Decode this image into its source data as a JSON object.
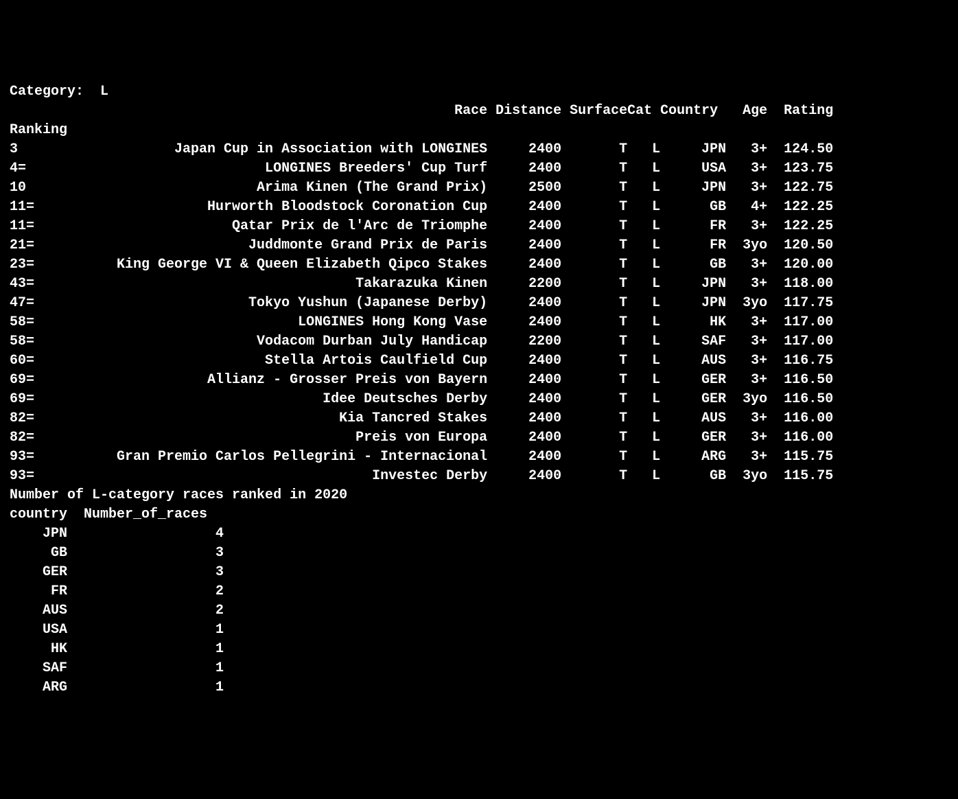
{
  "category_label": "Category:  L",
  "headers": {
    "ranking": "Ranking",
    "race": "Race",
    "distance": "Distance",
    "surface": "Surface",
    "cat": "Cat",
    "country": "Country",
    "age": "Age",
    "rating": "Rating"
  },
  "races": [
    {
      "ranking": "3",
      "race": "Japan Cup in Association with LONGINES",
      "distance": "2400",
      "surface": "T",
      "cat": "L",
      "country": "JPN",
      "age": "3+",
      "rating": "124.50"
    },
    {
      "ranking": "4=",
      "race": "LONGINES Breeders' Cup Turf",
      "distance": "2400",
      "surface": "T",
      "cat": "L",
      "country": "USA",
      "age": "3+",
      "rating": "123.75"
    },
    {
      "ranking": "10",
      "race": "Arima Kinen (The Grand Prix)",
      "distance": "2500",
      "surface": "T",
      "cat": "L",
      "country": "JPN",
      "age": "3+",
      "rating": "122.75"
    },
    {
      "ranking": "11=",
      "race": "Hurworth Bloodstock Coronation Cup",
      "distance": "2400",
      "surface": "T",
      "cat": "L",
      "country": "GB",
      "age": "4+",
      "rating": "122.25"
    },
    {
      "ranking": "11=",
      "race": "Qatar Prix de l'Arc de Triomphe",
      "distance": "2400",
      "surface": "T",
      "cat": "L",
      "country": "FR",
      "age": "3+",
      "rating": "122.25"
    },
    {
      "ranking": "21=",
      "race": "Juddmonte Grand Prix de Paris",
      "distance": "2400",
      "surface": "T",
      "cat": "L",
      "country": "FR",
      "age": "3yo",
      "rating": "120.50"
    },
    {
      "ranking": "23=",
      "race": "King George VI & Queen Elizabeth Qipco Stakes",
      "distance": "2400",
      "surface": "T",
      "cat": "L",
      "country": "GB",
      "age": "3+",
      "rating": "120.00"
    },
    {
      "ranking": "43=",
      "race": "Takarazuka Kinen",
      "distance": "2200",
      "surface": "T",
      "cat": "L",
      "country": "JPN",
      "age": "3+",
      "rating": "118.00"
    },
    {
      "ranking": "47=",
      "race": "Tokyo Yushun (Japanese Derby)",
      "distance": "2400",
      "surface": "T",
      "cat": "L",
      "country": "JPN",
      "age": "3yo",
      "rating": "117.75"
    },
    {
      "ranking": "58=",
      "race": "LONGINES Hong Kong Vase",
      "distance": "2400",
      "surface": "T",
      "cat": "L",
      "country": "HK",
      "age": "3+",
      "rating": "117.00"
    },
    {
      "ranking": "58=",
      "race": "Vodacom Durban July Handicap",
      "distance": "2200",
      "surface": "T",
      "cat": "L",
      "country": "SAF",
      "age": "3+",
      "rating": "117.00"
    },
    {
      "ranking": "60=",
      "race": "Stella Artois Caulfield Cup",
      "distance": "2400",
      "surface": "T",
      "cat": "L",
      "country": "AUS",
      "age": "3+",
      "rating": "116.75"
    },
    {
      "ranking": "69=",
      "race": "Allianz - Grosser Preis von Bayern",
      "distance": "2400",
      "surface": "T",
      "cat": "L",
      "country": "GER",
      "age": "3+",
      "rating": "116.50"
    },
    {
      "ranking": "69=",
      "race": "Idee Deutsches Derby",
      "distance": "2400",
      "surface": "T",
      "cat": "L",
      "country": "GER",
      "age": "3yo",
      "rating": "116.50"
    },
    {
      "ranking": "82=",
      "race": "Kia Tancred Stakes",
      "distance": "2400",
      "surface": "T",
      "cat": "L",
      "country": "AUS",
      "age": "3+",
      "rating": "116.00"
    },
    {
      "ranking": "82=",
      "race": "Preis von Europa",
      "distance": "2400",
      "surface": "T",
      "cat": "L",
      "country": "GER",
      "age": "3+",
      "rating": "116.00"
    },
    {
      "ranking": "93=",
      "race": "Gran Premio Carlos Pellegrini - Internacional",
      "distance": "2400",
      "surface": "T",
      "cat": "L",
      "country": "ARG",
      "age": "3+",
      "rating": "115.75"
    },
    {
      "ranking": "93=",
      "race": "Investec Derby",
      "distance": "2400",
      "surface": "T",
      "cat": "L",
      "country": "GB",
      "age": "3yo",
      "rating": "115.75"
    }
  ],
  "summary_title": "Number of L-category races ranked in 2020",
  "summary_headers": {
    "country": "country",
    "number": "Number_of_races"
  },
  "summary_rows": [
    {
      "country": "JPN",
      "number": "4"
    },
    {
      "country": "GB",
      "number": "3"
    },
    {
      "country": "GER",
      "number": "3"
    },
    {
      "country": "FR",
      "number": "2"
    },
    {
      "country": "AUS",
      "number": "2"
    },
    {
      "country": "USA",
      "number": "1"
    },
    {
      "country": "HK",
      "number": "1"
    },
    {
      "country": "SAF",
      "number": "1"
    },
    {
      "country": "ARG",
      "number": "1"
    }
  ],
  "chart_data": [
    {
      "type": "table",
      "title": "Category: L races",
      "columns": [
        "Ranking",
        "Race",
        "Distance",
        "Surface",
        "Cat",
        "Country",
        "Age",
        "Rating"
      ],
      "rows": [
        [
          "3",
          "Japan Cup in Association with LONGINES",
          2400,
          "T",
          "L",
          "JPN",
          "3+",
          124.5
        ],
        [
          "4=",
          "LONGINES Breeders' Cup Turf",
          2400,
          "T",
          "L",
          "USA",
          "3+",
          123.75
        ],
        [
          "10",
          "Arima Kinen (The Grand Prix)",
          2500,
          "T",
          "L",
          "JPN",
          "3+",
          122.75
        ],
        [
          "11=",
          "Hurworth Bloodstock Coronation Cup",
          2400,
          "T",
          "L",
          "GB",
          "4+",
          122.25
        ],
        [
          "11=",
          "Qatar Prix de l'Arc de Triomphe",
          2400,
          "T",
          "L",
          "FR",
          "3+",
          122.25
        ],
        [
          "21=",
          "Juddmonte Grand Prix de Paris",
          2400,
          "T",
          "L",
          "FR",
          "3yo",
          120.5
        ],
        [
          "23=",
          "King George VI & Queen Elizabeth Qipco Stakes",
          2400,
          "T",
          "L",
          "GB",
          "3+",
          120.0
        ],
        [
          "43=",
          "Takarazuka Kinen",
          2200,
          "T",
          "L",
          "JPN",
          "3+",
          118.0
        ],
        [
          "47=",
          "Tokyo Yushun (Japanese Derby)",
          2400,
          "T",
          "L",
          "JPN",
          "3yo",
          117.75
        ],
        [
          "58=",
          "LONGINES Hong Kong Vase",
          2400,
          "T",
          "L",
          "HK",
          "3+",
          117.0
        ],
        [
          "58=",
          "Vodacom Durban July Handicap",
          2200,
          "T",
          "L",
          "SAF",
          "3+",
          117.0
        ],
        [
          "60=",
          "Stella Artois Caulfield Cup",
          2400,
          "T",
          "L",
          "AUS",
          "3+",
          116.75
        ],
        [
          "69=",
          "Allianz - Grosser Preis von Bayern",
          2400,
          "T",
          "L",
          "GER",
          "3+",
          116.5
        ],
        [
          "69=",
          "Idee Deutsches Derby",
          2400,
          "T",
          "L",
          "GER",
          "3yo",
          116.5
        ],
        [
          "82=",
          "Kia Tancred Stakes",
          2400,
          "T",
          "L",
          "AUS",
          "3+",
          116.0
        ],
        [
          "82=",
          "Preis von Europa",
          2400,
          "T",
          "L",
          "GER",
          "3+",
          116.0
        ],
        [
          "93=",
          "Gran Premio Carlos Pellegrini - Internacional",
          2400,
          "T",
          "L",
          "ARG",
          "3+",
          115.75
        ],
        [
          "93=",
          "Investec Derby",
          2400,
          "T",
          "L",
          "GB",
          "3yo",
          115.75
        ]
      ]
    },
    {
      "type": "table",
      "title": "Number of L-category races ranked in 2020",
      "columns": [
        "country",
        "Number_of_races"
      ],
      "rows": [
        [
          "JPN",
          4
        ],
        [
          "GB",
          3
        ],
        [
          "GER",
          3
        ],
        [
          "FR",
          2
        ],
        [
          "AUS",
          2
        ],
        [
          "USA",
          1
        ],
        [
          "HK",
          1
        ],
        [
          "SAF",
          1
        ],
        [
          "ARG",
          1
        ]
      ]
    }
  ]
}
